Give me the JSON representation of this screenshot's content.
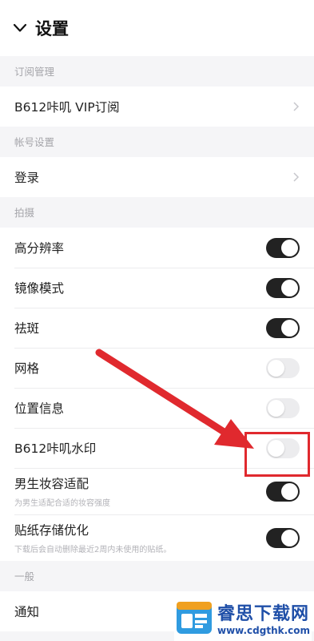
{
  "header": {
    "title": "设置",
    "back_icon": "chevron-down-icon"
  },
  "sections": {
    "subscription": {
      "label": "订阅管理",
      "items": [
        {
          "label": "B612咔叽 VIP订阅"
        }
      ]
    },
    "account": {
      "label": "帐号设置",
      "items": [
        {
          "label": "登录"
        }
      ]
    },
    "shooting": {
      "label": "拍摄",
      "items": [
        {
          "label": "高分辨率",
          "on": true
        },
        {
          "label": "镜像模式",
          "on": true
        },
        {
          "label": "祛斑",
          "on": true
        },
        {
          "label": "网格",
          "on": false
        },
        {
          "label": "位置信息",
          "on": false
        },
        {
          "label": "B612咔叽水印",
          "on": false
        },
        {
          "label": "男生妆容适配",
          "sub": "为男生适配合适的妆容强度",
          "on": true
        },
        {
          "label": "贴纸存储优化",
          "sub": "下载后会自动删除最近2周内未使用的贴纸。",
          "on": true
        }
      ]
    },
    "general": {
      "label": "一般",
      "items": [
        {
          "label": "通知"
        }
      ]
    }
  },
  "annotation": {
    "color": "#e0292e"
  },
  "watermark": {
    "brand": "睿思下载网",
    "url": "www.cdgthk.com"
  }
}
